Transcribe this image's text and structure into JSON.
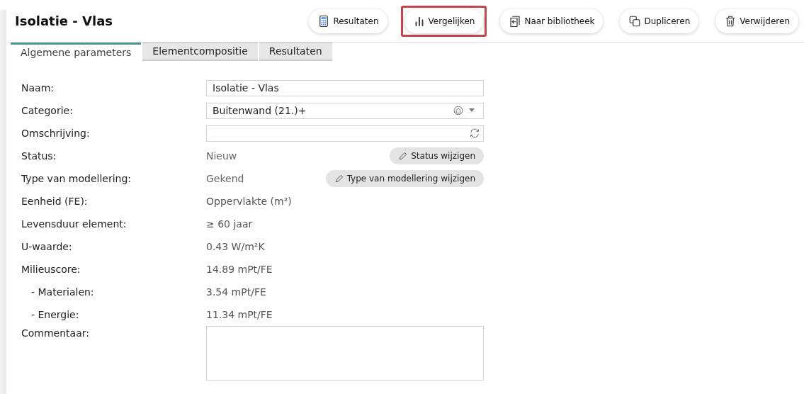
{
  "title": "Isolatie - Vlas",
  "toolbar": [
    {
      "label": "Resultaten",
      "highlighted": false
    },
    {
      "label": "Vergelijken",
      "highlighted": true
    },
    {
      "label": "Naar bibliotheek",
      "highlighted": false
    },
    {
      "label": "Dupliceren",
      "highlighted": false
    },
    {
      "label": "Verwijderen",
      "highlighted": false
    }
  ],
  "tabs": [
    {
      "label": "Algemene parameters",
      "selected": true
    },
    {
      "label": "Elementcompositie",
      "selected": false
    },
    {
      "label": "Resultaten",
      "selected": false
    }
  ],
  "fields": [
    {
      "kind": "input",
      "label": "Naam:",
      "value": "Isolatie - Vlas"
    },
    {
      "kind": "select",
      "label": "Categorie:",
      "value": "Buitenwand (21.)+"
    },
    {
      "kind": "translate",
      "label": "Omschrijving:"
    },
    {
      "kind": "action",
      "label": "Status:",
      "value": "Nieuw",
      "button": "Status wijzigen"
    },
    {
      "kind": "action",
      "label": "Type van modellering:",
      "value": "Gekend",
      "button": "Type van modellering wijzigen"
    },
    {
      "kind": "text",
      "label": "Eenheid (FE):",
      "value": "Oppervlakte (m²)"
    },
    {
      "kind": "text",
      "label": "Levensduur element:",
      "value": "≥ 60 jaar"
    },
    {
      "kind": "text",
      "label": "U-waarde:",
      "value": "0.43 W/m²K"
    },
    {
      "kind": "text",
      "label": "Milieuscore:",
      "value": "14.89 mPt/FE",
      "children": [
        {
          "kind": "text",
          "label": "- Materialen:",
          "value": "3.54 mPt/FE"
        },
        {
          "kind": "text",
          "label": "- Energie:",
          "value": "11.34 mPt/FE"
        }
      ]
    },
    {
      "kind": "textarea",
      "label": "Commentaar:"
    }
  ]
}
